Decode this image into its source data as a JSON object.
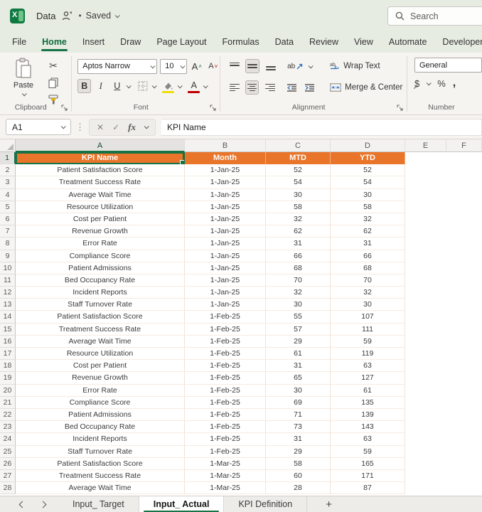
{
  "titlebar": {
    "doc_title": "Data",
    "saved_label": "Saved"
  },
  "search": {
    "placeholder": "Search"
  },
  "ribbon": {
    "active_tab": "Home",
    "tabs": [
      "File",
      "Home",
      "Insert",
      "Draw",
      "Page Layout",
      "Formulas",
      "Data",
      "Review",
      "View",
      "Automate",
      "Developer",
      "Help"
    ],
    "clipboard": {
      "label": "Clipboard",
      "paste": "Paste"
    },
    "font": {
      "label": "Font",
      "font_name": "Aptos Narrow",
      "font_size": "10",
      "bold": "B",
      "italic": "I",
      "underline": "U",
      "font_color": "A",
      "grow": "A",
      "shrink": "A"
    },
    "alignment": {
      "label": "Alignment",
      "wrap_text": "Wrap Text",
      "merge_center": "Merge & Center",
      "orientation": "ab"
    },
    "number": {
      "label": "Number",
      "format": "General",
      "dollar": "$",
      "percent": "%",
      "comma": ","
    }
  },
  "formula_bar": {
    "name_box": "A1",
    "cancel": "✕",
    "enter": "✓",
    "fx": "fx",
    "formula": "KPI Name"
  },
  "grid": {
    "column_headers": [
      "A",
      "B",
      "C",
      "D",
      "E",
      "F"
    ],
    "header_row": [
      "KPI Name",
      "Month",
      "MTD",
      "YTD"
    ],
    "rows": [
      {
        "n": 2,
        "kpi": "Patient Satisfaction Score",
        "month": "1-Jan-25",
        "mtd": "52",
        "ytd": "52"
      },
      {
        "n": 3,
        "kpi": "Treatment Success Rate",
        "month": "1-Jan-25",
        "mtd": "54",
        "ytd": "54"
      },
      {
        "n": 4,
        "kpi": "Average Wait Time",
        "month": "1-Jan-25",
        "mtd": "30",
        "ytd": "30"
      },
      {
        "n": 5,
        "kpi": "Resource Utilization",
        "month": "1-Jan-25",
        "mtd": "58",
        "ytd": "58"
      },
      {
        "n": 6,
        "kpi": "Cost per Patient",
        "month": "1-Jan-25",
        "mtd": "32",
        "ytd": "32"
      },
      {
        "n": 7,
        "kpi": "Revenue Growth",
        "month": "1-Jan-25",
        "mtd": "62",
        "ytd": "62"
      },
      {
        "n": 8,
        "kpi": "Error Rate",
        "month": "1-Jan-25",
        "mtd": "31",
        "ytd": "31"
      },
      {
        "n": 9,
        "kpi": "Compliance Score",
        "month": "1-Jan-25",
        "mtd": "66",
        "ytd": "66"
      },
      {
        "n": 10,
        "kpi": "Patient Admissions",
        "month": "1-Jan-25",
        "mtd": "68",
        "ytd": "68"
      },
      {
        "n": 11,
        "kpi": "Bed Occupancy Rate",
        "month": "1-Jan-25",
        "mtd": "70",
        "ytd": "70"
      },
      {
        "n": 12,
        "kpi": "Incident Reports",
        "month": "1-Jan-25",
        "mtd": "32",
        "ytd": "32"
      },
      {
        "n": 13,
        "kpi": "Staff Turnover Rate",
        "month": "1-Jan-25",
        "mtd": "30",
        "ytd": "30"
      },
      {
        "n": 14,
        "kpi": "Patient Satisfaction Score",
        "month": "1-Feb-25",
        "mtd": "55",
        "ytd": "107"
      },
      {
        "n": 15,
        "kpi": "Treatment Success Rate",
        "month": "1-Feb-25",
        "mtd": "57",
        "ytd": "111"
      },
      {
        "n": 16,
        "kpi": "Average Wait Time",
        "month": "1-Feb-25",
        "mtd": "29",
        "ytd": "59"
      },
      {
        "n": 17,
        "kpi": "Resource Utilization",
        "month": "1-Feb-25",
        "mtd": "61",
        "ytd": "119"
      },
      {
        "n": 18,
        "kpi": "Cost per Patient",
        "month": "1-Feb-25",
        "mtd": "31",
        "ytd": "63"
      },
      {
        "n": 19,
        "kpi": "Revenue Growth",
        "month": "1-Feb-25",
        "mtd": "65",
        "ytd": "127"
      },
      {
        "n": 20,
        "kpi": "Error Rate",
        "month": "1-Feb-25",
        "mtd": "30",
        "ytd": "61"
      },
      {
        "n": 21,
        "kpi": "Compliance Score",
        "month": "1-Feb-25",
        "mtd": "69",
        "ytd": "135"
      },
      {
        "n": 22,
        "kpi": "Patient Admissions",
        "month": "1-Feb-25",
        "mtd": "71",
        "ytd": "139"
      },
      {
        "n": 23,
        "kpi": "Bed Occupancy Rate",
        "month": "1-Feb-25",
        "mtd": "73",
        "ytd": "143"
      },
      {
        "n": 24,
        "kpi": "Incident Reports",
        "month": "1-Feb-25",
        "mtd": "31",
        "ytd": "63"
      },
      {
        "n": 25,
        "kpi": "Staff Turnover Rate",
        "month": "1-Feb-25",
        "mtd": "29",
        "ytd": "59"
      },
      {
        "n": 26,
        "kpi": "Patient Satisfaction Score",
        "month": "1-Mar-25",
        "mtd": "58",
        "ytd": "165"
      },
      {
        "n": 27,
        "kpi": "Treatment Success Rate",
        "month": "1-Mar-25",
        "mtd": "60",
        "ytd": "171"
      },
      {
        "n": 28,
        "kpi": "Average Wait Time",
        "month": "1-Mar-25",
        "mtd": "28",
        "ytd": "87"
      }
    ]
  },
  "sheet_tabs": {
    "tabs": [
      {
        "label": "Input_ Target",
        "active": false
      },
      {
        "label": "Input_ Actual",
        "active": true
      },
      {
        "label": "KPI Definition",
        "active": false
      }
    ],
    "add_label": "+"
  },
  "colors": {
    "accent_green": "#177245",
    "header_orange": "#e8752a",
    "fill_yellow": "#f2dd0c",
    "font_red": "#c00000"
  }
}
